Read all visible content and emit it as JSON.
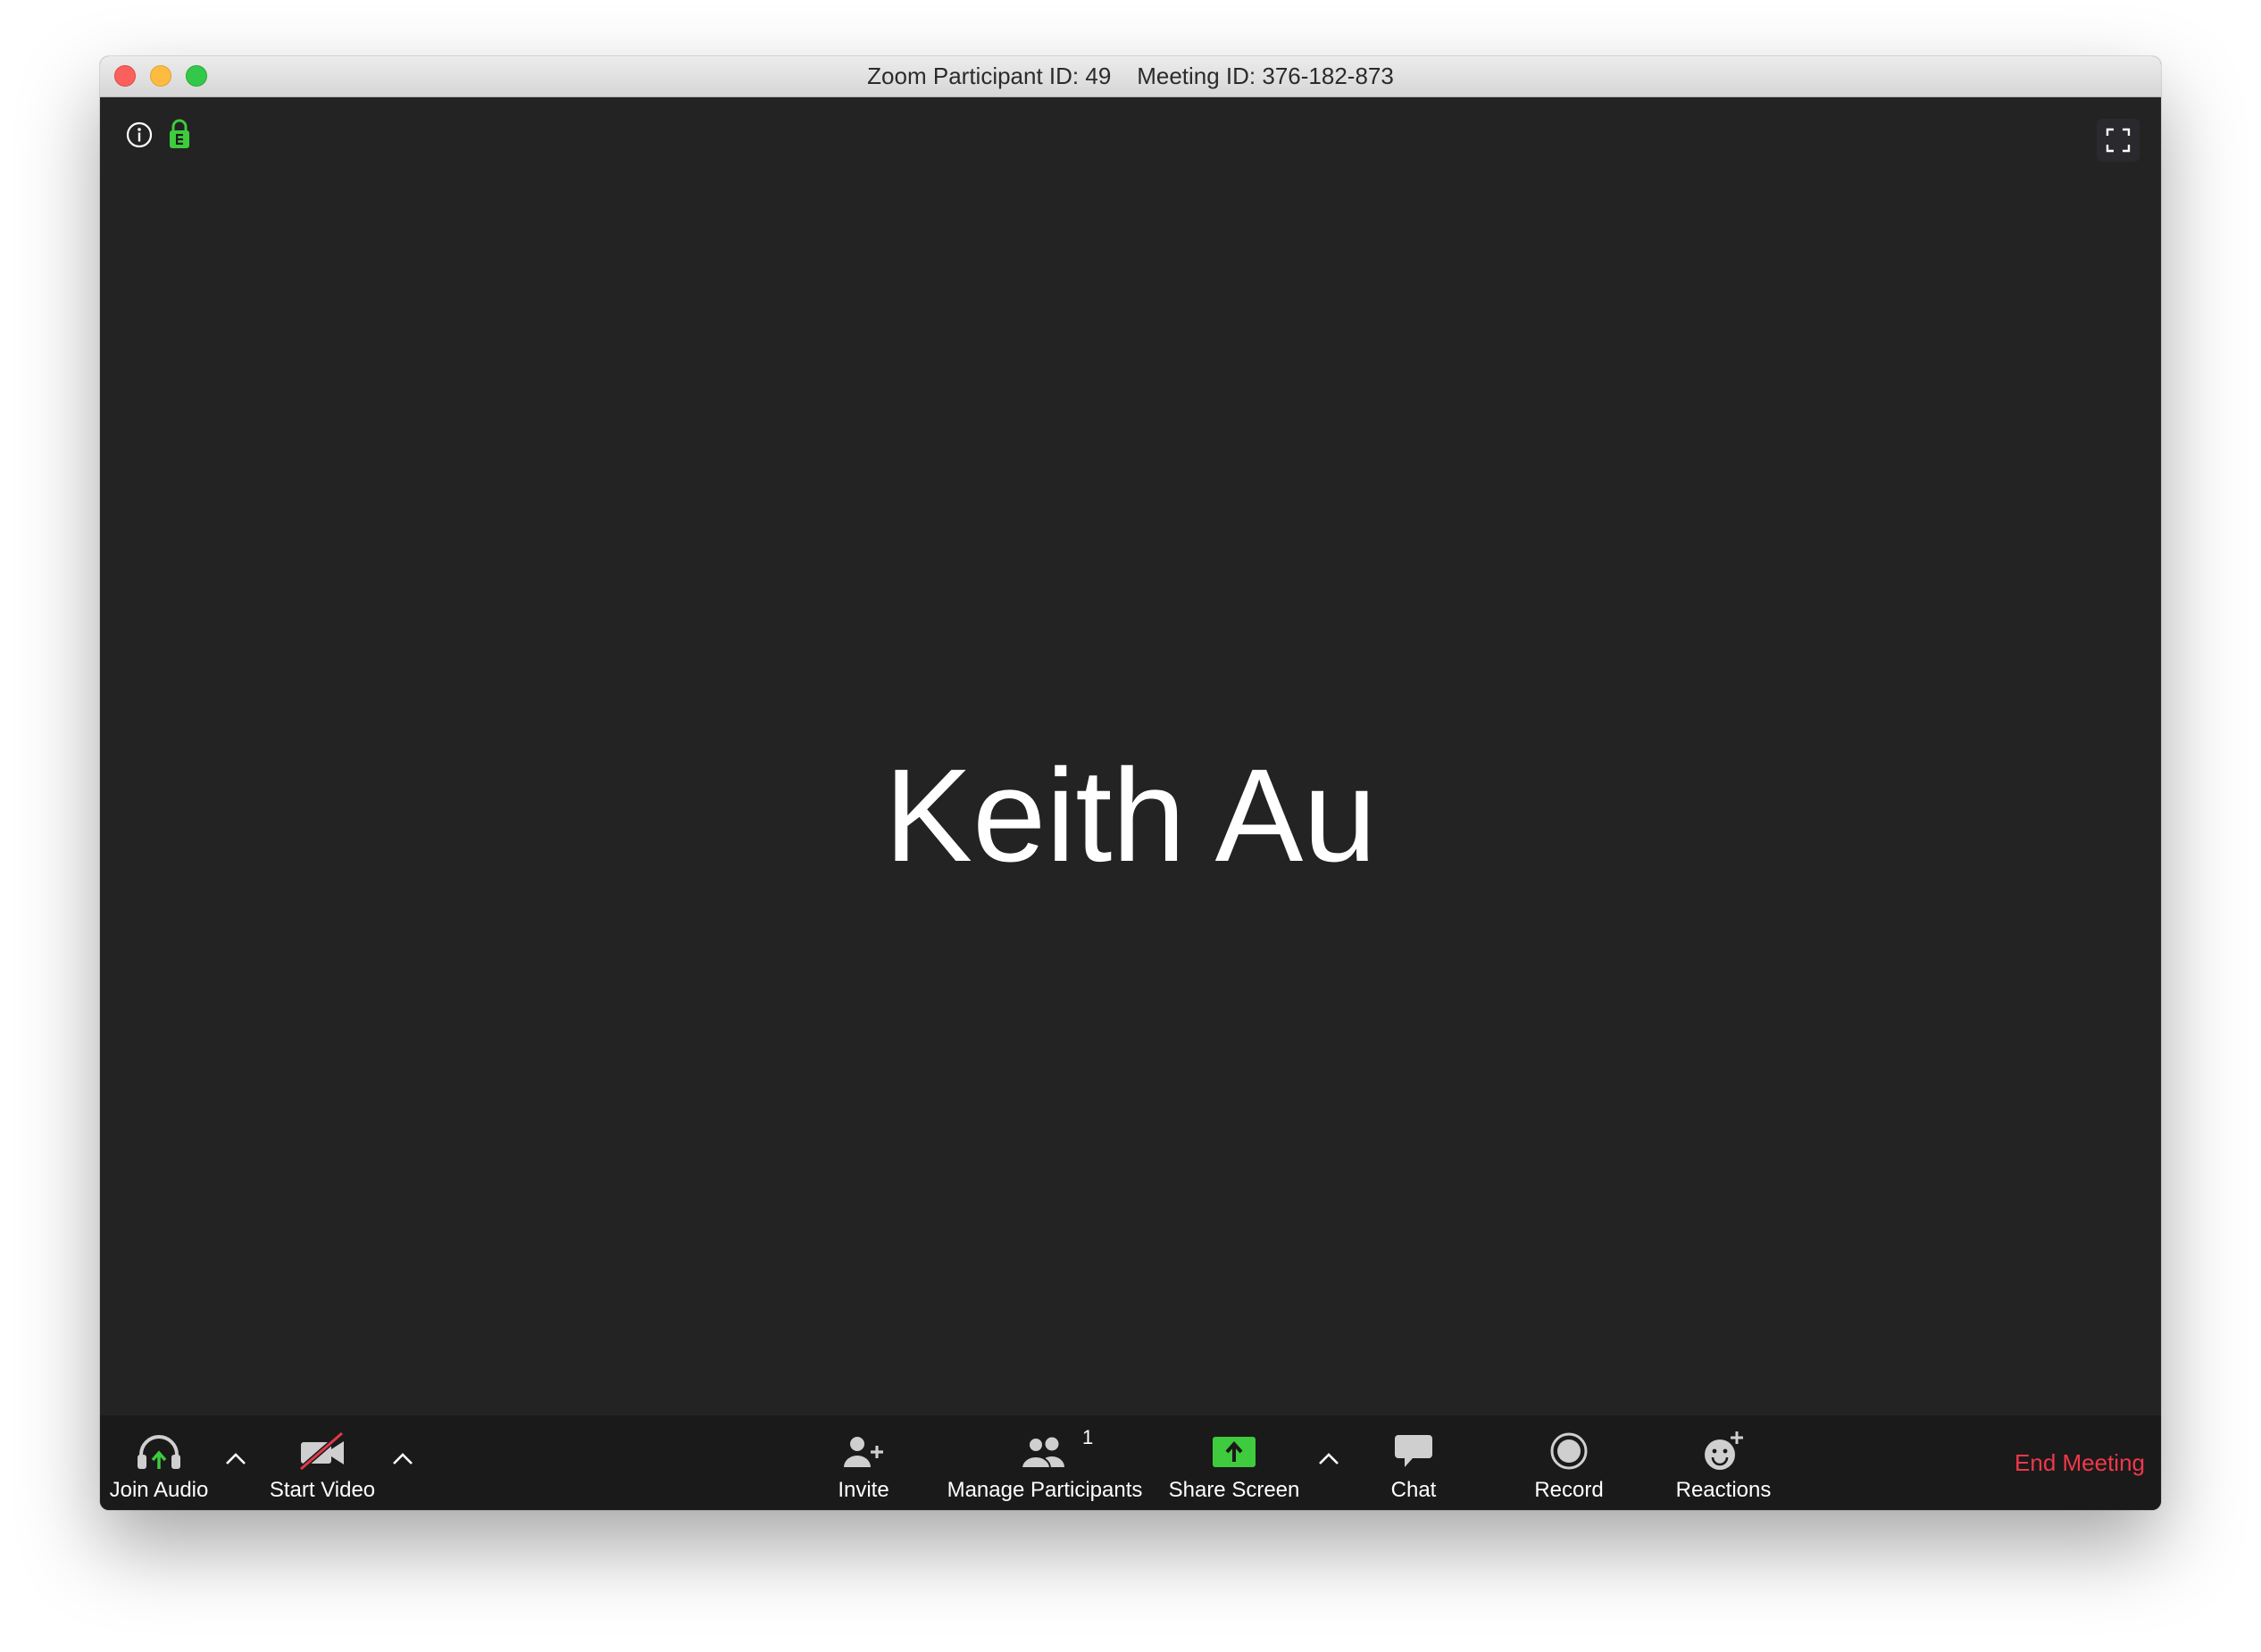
{
  "window": {
    "title_participant": "Zoom Participant ID: 49",
    "title_meeting": "Meeting ID: 376-182-873"
  },
  "stage": {
    "participant_name": "Keith Au"
  },
  "toolbar": {
    "join_audio": "Join Audio",
    "start_video": "Start Video",
    "invite": "Invite",
    "manage_participants": "Manage Participants",
    "participant_count": "1",
    "share_screen": "Share Screen",
    "chat": "Chat",
    "record": "Record",
    "reactions": "Reactions",
    "end_meeting": "End Meeting"
  },
  "icons": {
    "info": "info-icon",
    "lock": "encryption-lock-icon",
    "fullscreen": "fullscreen-icon",
    "audio": "headphones-icon",
    "video": "video-camera-off-icon",
    "invite": "add-person-icon",
    "participants": "people-icon",
    "share": "share-screen-icon",
    "chat": "chat-bubble-icon",
    "record": "record-icon",
    "reactions": "emoji-add-icon",
    "caret": "chevron-up-icon"
  },
  "colors": {
    "stage_bg": "#232323",
    "toolbar_bg": "#1a1a1a",
    "accent_green": "#3ecb3e",
    "end_meeting_red": "#f0384a",
    "video_off_red": "#e0394a"
  }
}
